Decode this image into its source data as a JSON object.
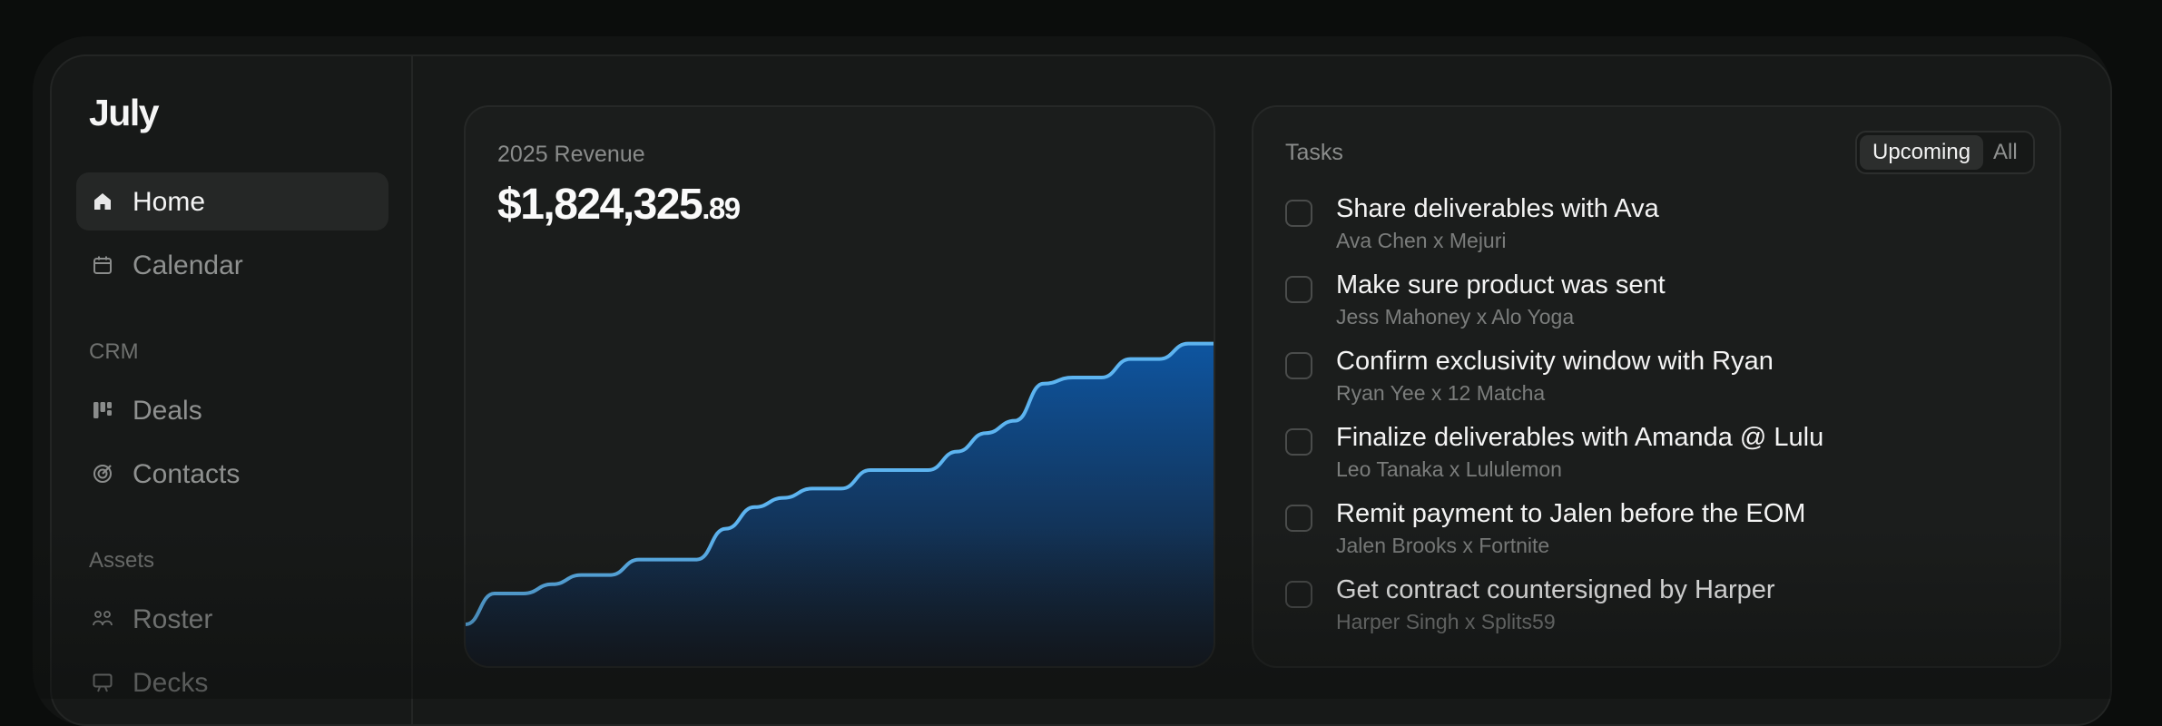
{
  "app": {
    "logo": "July"
  },
  "sidebar": {
    "nav": [
      {
        "label": "Home",
        "icon": "home-icon",
        "active": true
      },
      {
        "label": "Calendar",
        "icon": "calendar-icon",
        "active": false
      }
    ],
    "sections": [
      {
        "label": "CRM",
        "items": [
          {
            "label": "Deals",
            "icon": "kanban-icon"
          },
          {
            "label": "Contacts",
            "icon": "target-icon"
          }
        ]
      },
      {
        "label": "Assets",
        "items": [
          {
            "label": "Roster",
            "icon": "people-icon"
          },
          {
            "label": "Decks",
            "icon": "presentation-icon"
          }
        ]
      }
    ]
  },
  "revenue": {
    "title": "2025 Revenue",
    "value_main": "$1,824,325",
    "value_cents": ".89",
    "colors": {
      "line": "#5db4f0",
      "fill_top": "#0e55a0",
      "fill_bottom": "#161a22"
    }
  },
  "chart_data": {
    "type": "area",
    "title": "2025 Revenue",
    "xlabel": "",
    "ylabel": "",
    "grid": false,
    "legend": "none",
    "x": [
      0,
      1,
      2,
      3,
      4,
      5,
      6,
      7,
      8,
      9,
      10,
      11,
      12,
      13,
      14,
      15,
      16,
      17,
      18,
      19,
      20,
      21,
      22,
      23,
      24,
      25,
      26
    ],
    "values": [
      0.0,
      0.1,
      0.1,
      0.13,
      0.16,
      0.16,
      0.21,
      0.21,
      0.21,
      0.31,
      0.38,
      0.41,
      0.44,
      0.44,
      0.5,
      0.5,
      0.5,
      0.56,
      0.62,
      0.66,
      0.78,
      0.8,
      0.8,
      0.86,
      0.86,
      0.91,
      0.91
    ],
    "ylim": [
      0,
      1
    ]
  },
  "tasks": {
    "title": "Tasks",
    "filters": [
      {
        "label": "Upcoming",
        "active": true
      },
      {
        "label": "All",
        "active": false
      }
    ],
    "items": [
      {
        "title": "Share deliverables with Ava",
        "subtitle": "Ava Chen x Mejuri"
      },
      {
        "title": "Make sure product was sent",
        "subtitle": "Jess Mahoney x Alo Yoga"
      },
      {
        "title": "Confirm exclusivity window with Ryan",
        "subtitle": "Ryan Yee x 12 Matcha"
      },
      {
        "title": "Finalize deliverables with Amanda @ Lulu",
        "subtitle": "Leo Tanaka x Lululemon"
      },
      {
        "title": "Remit payment to Jalen before the EOM",
        "subtitle": "Jalen Brooks x Fortnite"
      },
      {
        "title": "Get contract countersigned by Harper",
        "subtitle": "Harper Singh x Splits59"
      }
    ]
  }
}
